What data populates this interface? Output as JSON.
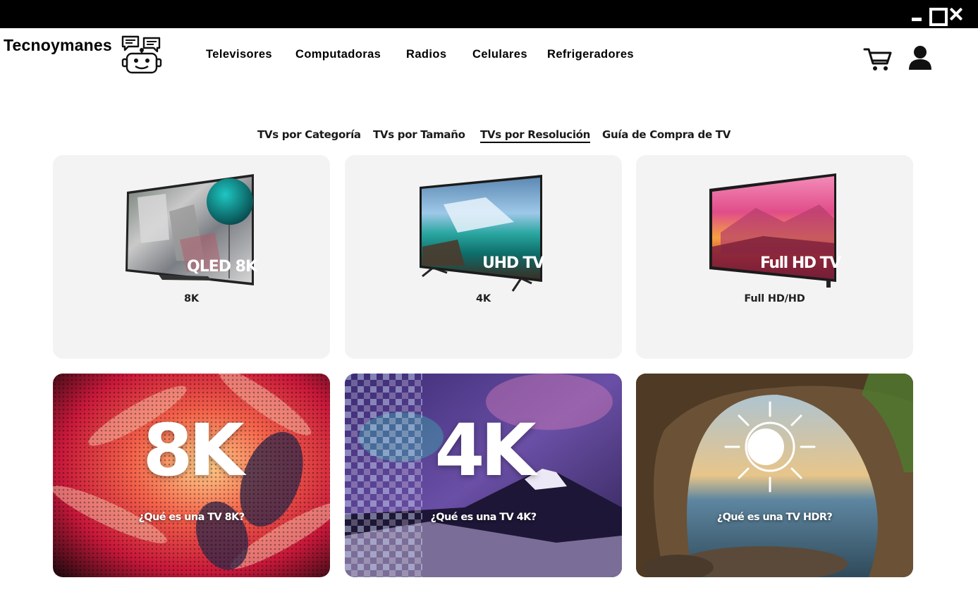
{
  "window": {
    "controls": {
      "minimize": "minimize-icon",
      "maximize": "maximize-icon",
      "close": "close-icon"
    }
  },
  "header": {
    "brand": "Tecnoymanes",
    "logo_icon": "robot-chat-icon",
    "nav": [
      "Televisores",
      "Computadoras",
      "Radios",
      "Celulares",
      "Refrigeradores"
    ],
    "cart_icon": "shopping-cart-icon",
    "user_icon": "user-account-icon"
  },
  "subnav": {
    "tabs": [
      "TVs por Categoría",
      "TVs por Tamaño",
      "TVs por Resolución",
      "Guía de Compra de TV"
    ],
    "active_tab": "TVs por Resolución"
  },
  "products": [
    {
      "label": "8K",
      "screen_text": "QLED 8K"
    },
    {
      "label": "4K",
      "screen_text": "UHD TV"
    },
    {
      "label": "Full HD/HD",
      "screen_text": "Full HD TV"
    }
  ],
  "banners": [
    {
      "headline": "8K",
      "question": "¿Qué es una TV 8K?"
    },
    {
      "headline": "4K",
      "question": "¿Qué es una TV 4K?"
    },
    {
      "headline": "",
      "question": "¿Qué es una TV HDR?",
      "icon": "sun-icon"
    }
  ],
  "colors": {
    "titlebar": "#000000",
    "card_bg": "#f3f3f3",
    "text": "#000000"
  }
}
